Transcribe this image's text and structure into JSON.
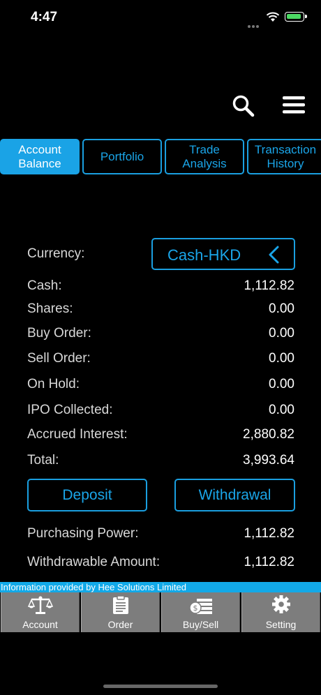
{
  "status_bar": {
    "time": "4:47"
  },
  "tabs": [
    {
      "label": "Account\nBalance",
      "active": true
    },
    {
      "label": "Portfolio",
      "active": false
    },
    {
      "label": "Trade\nAnalysis",
      "active": false
    },
    {
      "label": "Transaction\nHistory",
      "active": false
    }
  ],
  "currency": {
    "label": "Currency:",
    "selected": "Cash-HKD"
  },
  "balance_rows": [
    {
      "label": "Cash:",
      "value": "1,112.82"
    },
    {
      "label": "Shares:",
      "value": "0.00"
    },
    {
      "label": "Buy Order:",
      "value": "0.00"
    },
    {
      "label": "Sell Order:",
      "value": "0.00"
    },
    {
      "label": "On Hold:",
      "value": "0.00"
    },
    {
      "label": "IPO Collected:",
      "value": "0.00"
    },
    {
      "label": "Accrued Interest:",
      "value": "2,880.82"
    },
    {
      "label": "Total:",
      "value": "3,993.64"
    }
  ],
  "actions": {
    "deposit_label": "Deposit",
    "withdrawal_label": "Withdrawal"
  },
  "summary_rows": [
    {
      "label": "Purchasing Power:",
      "value": "1,112.82"
    },
    {
      "label": "Withdrawable Amount:",
      "value": "1,112.82"
    }
  ],
  "info_bar": {
    "text": "Information provided by Hee Solutions Limited"
  },
  "bottom_nav": [
    {
      "label": "Account",
      "icon": "scale-icon"
    },
    {
      "label": "Order",
      "icon": "clipboard-icon"
    },
    {
      "label": "Buy/Sell",
      "icon": "money-icon"
    },
    {
      "label": "Setting",
      "icon": "gear-icon"
    }
  ],
  "colors": {
    "accent": "#1aa3e6",
    "background": "#000000",
    "nav_bg": "#7d7d7d"
  }
}
